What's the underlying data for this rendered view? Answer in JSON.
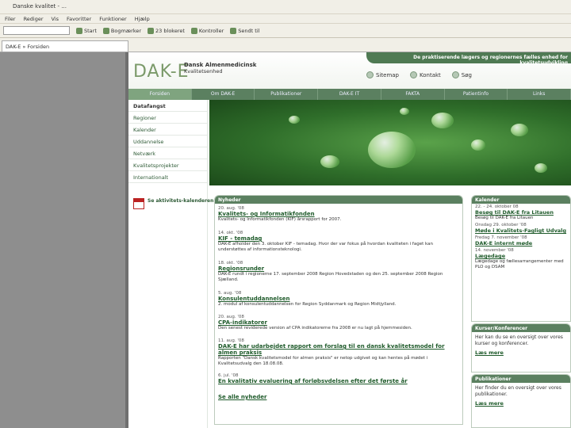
{
  "browser": {
    "title": "Danske kvalitet - ...",
    "menu": [
      "Filer",
      "Rediger",
      "Vis",
      "Favoritter",
      "Funktioner",
      "Hjælp"
    ],
    "toolbar": [
      "Start",
      "Bogmærker",
      "23 blokeret",
      "Kontroller",
      "Sendt til"
    ],
    "tab_label": "DAK-E » Forsiden"
  },
  "header": {
    "logo": "DAK-E",
    "org_line1": "Dansk Almenmedicinsk",
    "org_line2": "Kvalitetsenhed",
    "tagline": "De praktiserende lægers og regionernes fælles enhed for kvalitetsudvikling",
    "util_links": [
      "Sitemap",
      "Kontakt",
      "Søg"
    ]
  },
  "nav": [
    "Forsiden",
    "Om DAK-E",
    "Publikationer",
    "DAK-E IT",
    "FAKTA",
    "Patientinfo",
    "Links"
  ],
  "sidebar": {
    "items": [
      "Datafangst",
      "Regioner",
      "Kalender",
      "Uddannelse",
      "Netværk",
      "Kvalitetsprojekter",
      "Internationalt"
    ],
    "cta": "Se aktivitets-kalenderen"
  },
  "news": {
    "header": "Nyheder",
    "items": [
      {
        "date": "20. aug. '08",
        "title": "Kvalitets- og Informatikfonden",
        "body": "Kvalitets- og Informatikfonden (KIF) årsrapport for 2007."
      },
      {
        "date": "14. okt. '08",
        "title": "KIF - temadag",
        "body": "DAK-E afholder den 3. oktober KIF - temadag. Hvor der var fokus på hvordan kvaliteten i faget kan understøttes af informationsteknologi."
      },
      {
        "date": "18. okt. '08",
        "title": "Regionsrunder",
        "body": "DAK-E rundt i regionerne 17. september 2008 Region Hovedstaden og den 25. september 2008 Region Sjælland."
      },
      {
        "date": "5. aug. '08",
        "title": "Konsulentuddannelsen",
        "body": "2. modul af konsulentuddannelsen for Region Syddanmark og Region Midtjylland."
      },
      {
        "date": "20. aug. '08",
        "title": "CPA-indikatorer",
        "body": "Den senest reviderede version af CPA indikatorerne fra 2008 er nu lagt på hjemmesiden."
      },
      {
        "date": "11. aug. '08",
        "title": "DAK-E har udarbejdet rapport om forslag til en dansk kvalitetsmodel for almen praksis",
        "body": "Rapporten \"Dansk kvalitetsmodel for almen praksis\" er netop udgivet og kan hentes på mødet i Kvalitetsudvalg den 18.08.08."
      },
      {
        "date": "6. jul. '08",
        "title": "En kvalitativ evaluering af forløbsvdelsen efter det første år",
        "body": ""
      }
    ],
    "see_all": "Se alle nyheder"
  },
  "calendar": {
    "header": "Kalender",
    "items": [
      {
        "date": "22. - 24. oktober 08",
        "title": "Besøg til DAK-E fra Litauen",
        "body": "Besøg til DAK-E fra Litauen"
      },
      {
        "date": "Onsdag 29. oktober '08",
        "title": "Møde i Kvalitets-Fagligt Udvalg",
        "body": ""
      },
      {
        "date": "Fredag 7. november '08",
        "title": "DAK-E internt møde",
        "body": ""
      },
      {
        "date": "14. november '08",
        "title": "Lægedage",
        "body": "Lægedage og fællesarrangementer med PLO og DSAM"
      }
    ]
  },
  "courses": {
    "header": "Kurser/Konferencer",
    "text": "Her kan du se en oversigt over vores kurser og konferencer.",
    "link": "Læs mere"
  },
  "pubs": {
    "header": "Publikationer",
    "text": "Her finder du en oversigt over vores publikationer.",
    "link": "Læs mere"
  },
  "colors": {
    "brand": "#5b8060",
    "link": "#1f5b2b"
  }
}
